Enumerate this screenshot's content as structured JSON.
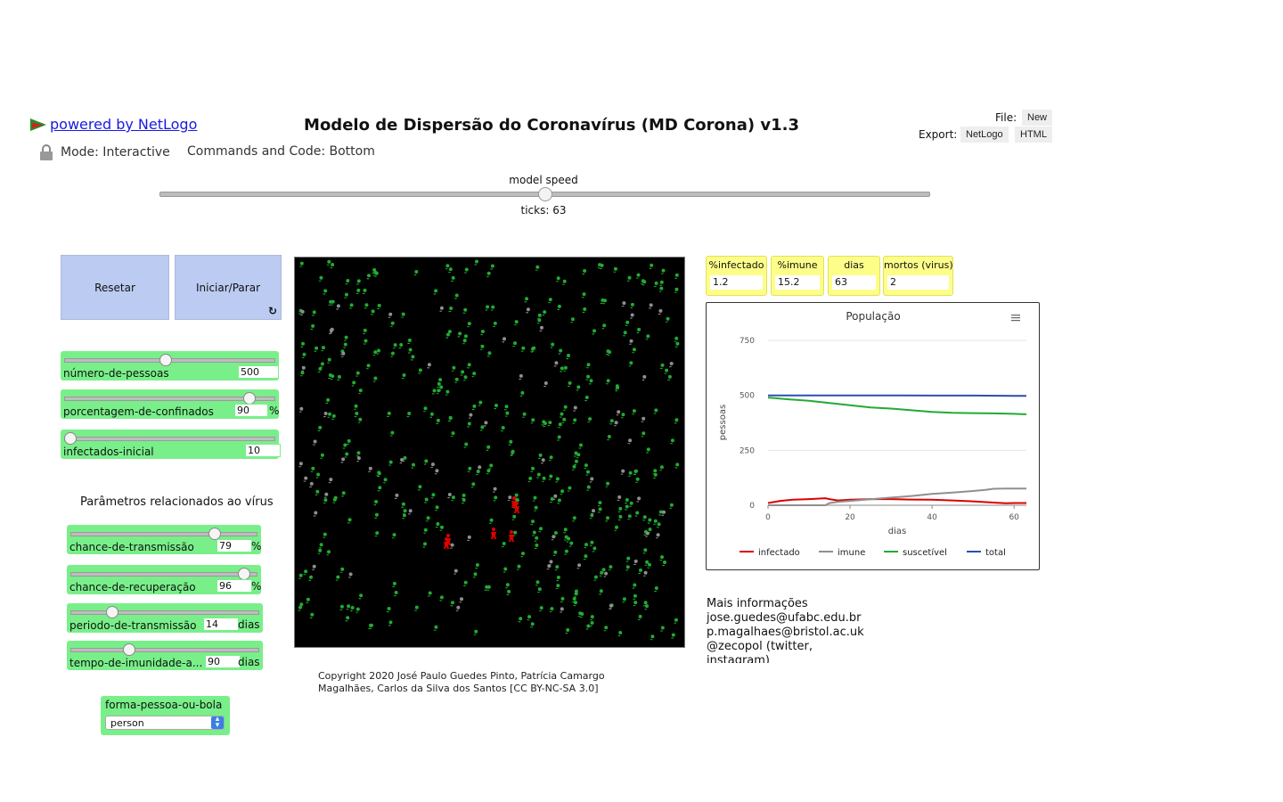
{
  "header": {
    "powered_by": "powered by NetLogo",
    "title": "Modelo de Dispersão do Coronavírus (MD Corona) v1.3",
    "mode": "Mode: Interactive",
    "commands": "Commands and Code: Bottom",
    "file_label": "File:",
    "file_new": "New",
    "export_label": "Export:",
    "export_netlogo": "NetLogo",
    "export_html": "HTML"
  },
  "speed": {
    "label": "model speed",
    "ticks": "ticks: 63",
    "value_fraction": 0.5
  },
  "buttons": {
    "reset": "Resetar",
    "go": "Iniciar/Parar",
    "forever_icon": "↻"
  },
  "sliders": [
    {
      "name": "número-de-pessoas",
      "value": "500",
      "unit": "",
      "fraction": 0.48
    },
    {
      "name": "porcentagem-de-confinados",
      "value": "90",
      "unit": "%",
      "fraction": 0.9
    },
    {
      "name": "infectados-inicial",
      "value": "10",
      "unit": "",
      "fraction": 0.0
    },
    {
      "name": "chance-de-transmissão",
      "value": "79",
      "unit": "%",
      "fraction": 0.79
    },
    {
      "name": "chance-de-recuperação",
      "value": "96",
      "unit": "%",
      "fraction": 0.96
    },
    {
      "name": "periodo-de-transmissão",
      "value": "14",
      "unit": "dias",
      "fraction": 0.2
    },
    {
      "name": "tempo-de-imunidade-a...",
      "value": "90",
      "unit": "dias",
      "fraction": 0.3
    }
  ],
  "virus_params_label": "Parâmetros relacionados ao vírus",
  "chooser": {
    "label": "forma-pessoa-ou-bola",
    "value": "person"
  },
  "copyright": "Copyright 2020 José Paulo Guedes Pinto, Patrícia Camargo Magalhães, Carlos da Silva dos Santos [CC BY-NC-SA 3.0]",
  "monitors": [
    {
      "label": "%infectado",
      "value": "1.2"
    },
    {
      "label": "%imune",
      "value": "15.2"
    },
    {
      "label": "dias",
      "value": "63"
    },
    {
      "label": "mortos (virus)",
      "value": "2"
    }
  ],
  "info": [
    "Mais informações",
    "jose.guedes@ufabc.edu.br",
    "p.magalhaes@bristol.ac.uk",
    "@zecopol (twitter,",
    "instagram)"
  ],
  "colors": {
    "infected": "#dd0000",
    "immune": "#8f8f8f",
    "susceptible": "#22aa33",
    "total": "#2e4fb0"
  },
  "chart_data": {
    "type": "line",
    "title": "População",
    "xlabel": "dias",
    "ylabel": "pessoas",
    "xlim": [
      0,
      63
    ],
    "ylim": [
      0,
      750
    ],
    "xticks": [
      "0",
      "20",
      "40",
      "60"
    ],
    "yticks": [
      "0",
      "250",
      "500",
      "750"
    ],
    "legend": "bottom",
    "series": [
      {
        "name": "infectado",
        "color": "#dd0000",
        "x": [
          0,
          3,
          6,
          10,
          14,
          15,
          17,
          20,
          25,
          30,
          35,
          40,
          45,
          50,
          55,
          58,
          60,
          63
        ],
        "y": [
          10,
          20,
          25,
          28,
          32,
          28,
          22,
          25,
          28,
          28,
          26,
          25,
          22,
          18,
          12,
          9,
          10,
          10
        ]
      },
      {
        "name": "imune",
        "color": "#8f8f8f",
        "x": [
          0,
          10,
          14,
          15,
          17,
          20,
          25,
          30,
          35,
          40,
          45,
          50,
          53,
          55,
          58,
          60,
          63
        ],
        "y": [
          0,
          0,
          0,
          10,
          15,
          20,
          27,
          35,
          42,
          52,
          58,
          65,
          70,
          75,
          76,
          76,
          76
        ]
      },
      {
        "name": "suscetível",
        "color": "#22aa33",
        "x": [
          0,
          5,
          10,
          15,
          20,
          25,
          30,
          35,
          40,
          45,
          50,
          55,
          60,
          63
        ],
        "y": [
          490,
          482,
          475,
          465,
          455,
          445,
          440,
          432,
          425,
          421,
          419,
          418,
          416,
          414
        ]
      },
      {
        "name": "total",
        "color": "#2e4fb0",
        "x": [
          0,
          10,
          20,
          30,
          40,
          50,
          60,
          63
        ],
        "y": [
          500,
          500,
          500,
          500,
          499,
          499,
          498,
          498
        ]
      }
    ]
  }
}
